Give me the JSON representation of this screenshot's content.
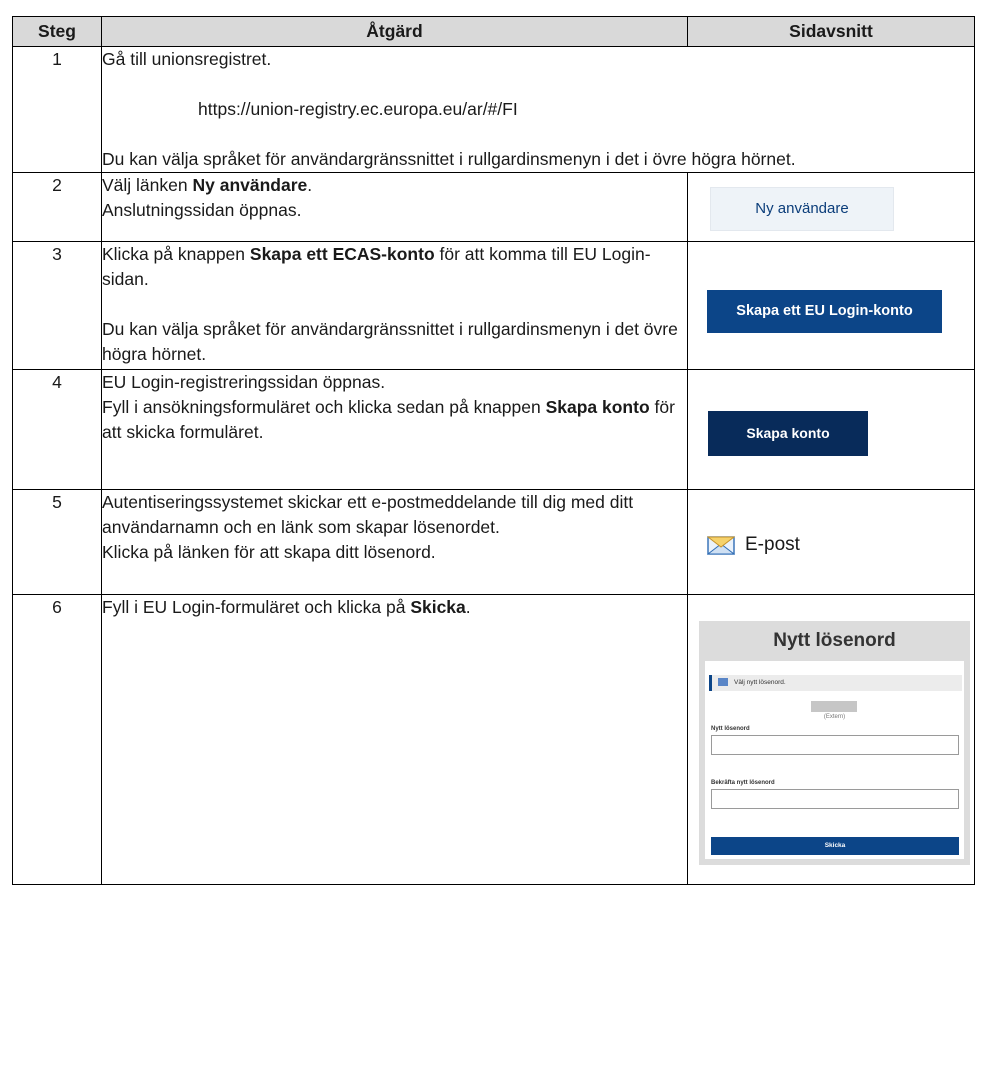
{
  "headers": {
    "step": "Steg",
    "action": "Åtgärd",
    "section": "Sidavsnitt"
  },
  "rows": [
    {
      "num": "1",
      "line1": "Gå till unionsregistret.",
      "url": "https://union-registry.ec.europa.eu/ar/#/FI",
      "note": "Du kan välja språket för användargränssnittet i rullgardinsmenyn i det i övre högra hörnet."
    },
    {
      "num": "2",
      "pre": "Välj länken ",
      "bold": "Ny användare",
      "post": ".",
      "line2": "Anslutningssidan öppnas.",
      "image_button": "Ny användare"
    },
    {
      "num": "3",
      "pre": "Klicka på knappen ",
      "bold": "Skapa ett ECAS-konto",
      "post": " för att komma till EU Login-sidan.",
      "note": "Du kan välja språket för användargränssnittet i rullgardinsmenyn i det övre högra hörnet.",
      "image_button": "Skapa ett EU Login-konto"
    },
    {
      "num": "4",
      "line1": "EU Login-registreringssidan öppnas.",
      "pre": "Fyll i ansökningsformuläret och klicka sedan på knappen ",
      "bold": "Skapa konto",
      "post": " för att skicka formuläret.",
      "image_button": "Skapa konto"
    },
    {
      "num": "5",
      "text": "Autentiseringssystemet skickar ett e-postmeddelande till dig med ditt användarnamn och en länk som skapar lösenordet.",
      "line2": "Klicka på länken för att skapa ditt lösenord.",
      "image_icon": "envelope-icon",
      "image_label": "E-post"
    },
    {
      "num": "6",
      "pre": "Fyll i EU Login-formuläret och klicka på ",
      "bold": "Skicka",
      "post": ".",
      "screenshot": {
        "title": "Nytt lösenord",
        "info": "Välj nytt lösenord.",
        "extern": "(Extern)",
        "new_label": "Nytt lösenord",
        "confirm_label": "Bekräfta nytt lösenord",
        "submit": "Skicka"
      }
    }
  ],
  "colors": {
    "header_bg": "#d9d9d9",
    "ec_blue": "#0c4588",
    "navy": "#082b5a"
  }
}
